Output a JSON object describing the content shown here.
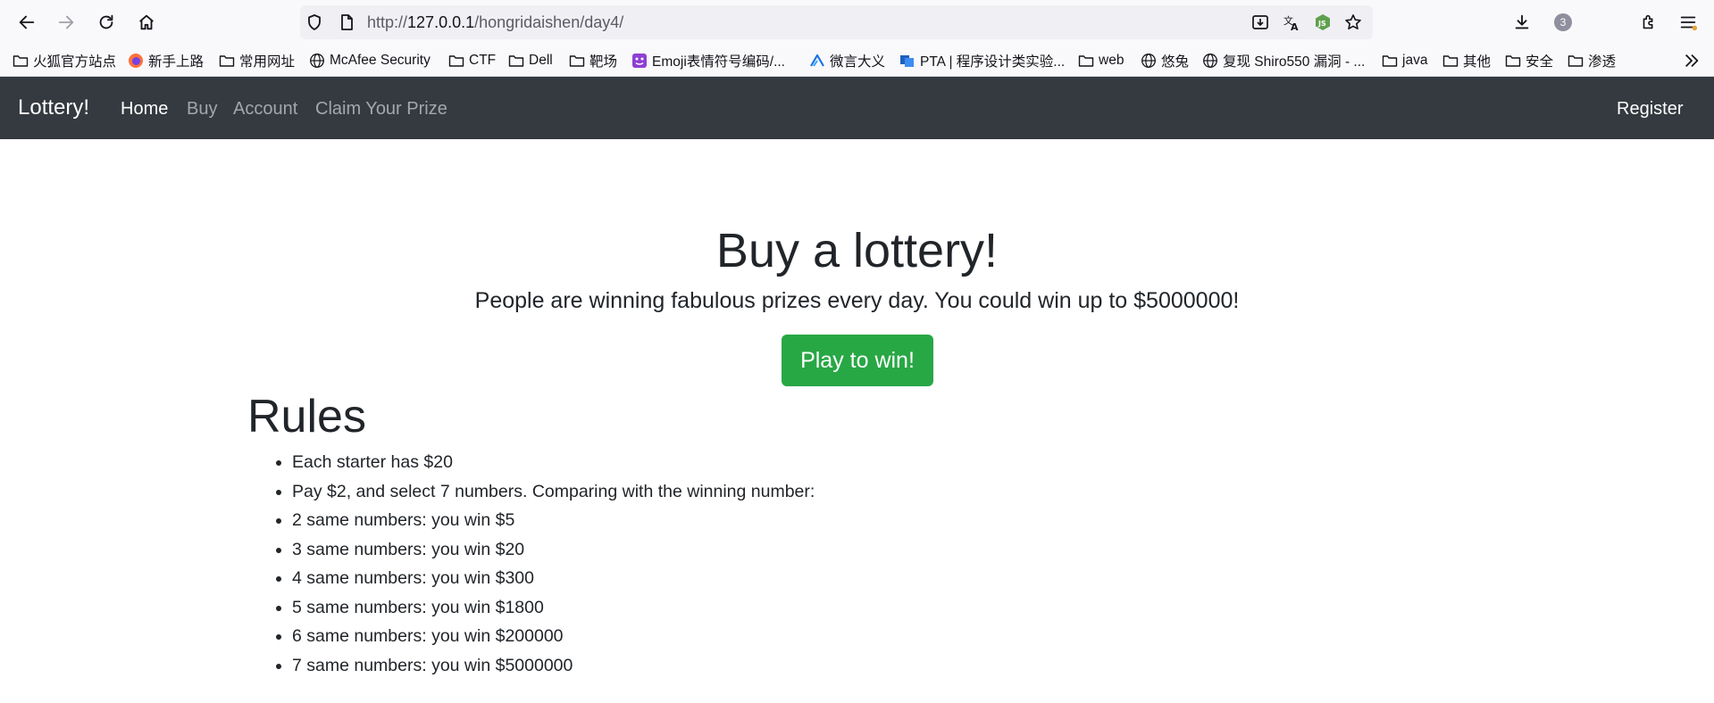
{
  "browser": {
    "url_prefix": "http://",
    "url_host": "127.0.0.1",
    "url_path": "/hongridaishen/day4/",
    "downloads_count": "3",
    "bookmarks": [
      {
        "label": "火狐官方站点",
        "icon": "folder-icon"
      },
      {
        "label": "新手上路",
        "icon": "firefox-icon"
      },
      {
        "label": "常用网址",
        "icon": "folder-icon"
      },
      {
        "label": "McAfee Security",
        "icon": "globe-icon"
      },
      {
        "label": "CTF",
        "icon": "folder-icon"
      },
      {
        "label": "Dell",
        "icon": "folder-icon"
      },
      {
        "label": "靶场",
        "icon": "folder-icon"
      },
      {
        "label": "Emoji表情符号编码/...",
        "icon": "emoji-site-icon"
      },
      {
        "label": "微言大义",
        "icon": "site-logo-icon"
      },
      {
        "label": "PTA | 程序设计类实验...",
        "icon": "pta-icon"
      },
      {
        "label": "web",
        "icon": "folder-icon"
      },
      {
        "label": "悠兔",
        "icon": "globe-icon"
      },
      {
        "label": "复现 Shiro550 漏洞 - ...",
        "icon": "globe-icon"
      },
      {
        "label": "java",
        "icon": "folder-icon"
      },
      {
        "label": "其他",
        "icon": "folder-icon"
      },
      {
        "label": "安全",
        "icon": "folder-icon"
      },
      {
        "label": "渗透",
        "icon": "folder-icon"
      }
    ]
  },
  "navbar": {
    "brand": "Lottery!",
    "links": [
      {
        "label": "Home",
        "active": true
      },
      {
        "label": "Buy",
        "active": false
      },
      {
        "label": "Account",
        "active": false
      },
      {
        "label": "Claim Your Prize",
        "active": false
      }
    ],
    "register": "Register"
  },
  "hero": {
    "title": "Buy a lottery!",
    "lead": "People are winning fabulous prizes every day. You could win up to $5000000!",
    "button": "Play to win!"
  },
  "rules": {
    "title": "Rules",
    "items": [
      "Each starter has $20",
      "Pay $2, and select 7 numbers. Comparing with the winning number:",
      "2 same numbers: you win $5",
      "3 same numbers: you win $20",
      "4 same numbers: you win $300",
      "5 same numbers: you win $1800",
      "6 same numbers: you win $200000",
      "7 same numbers: you win $5000000"
    ]
  },
  "colors": {
    "navbar_bg": "#343a40",
    "button_green": "#28a745",
    "text": "#212529"
  }
}
